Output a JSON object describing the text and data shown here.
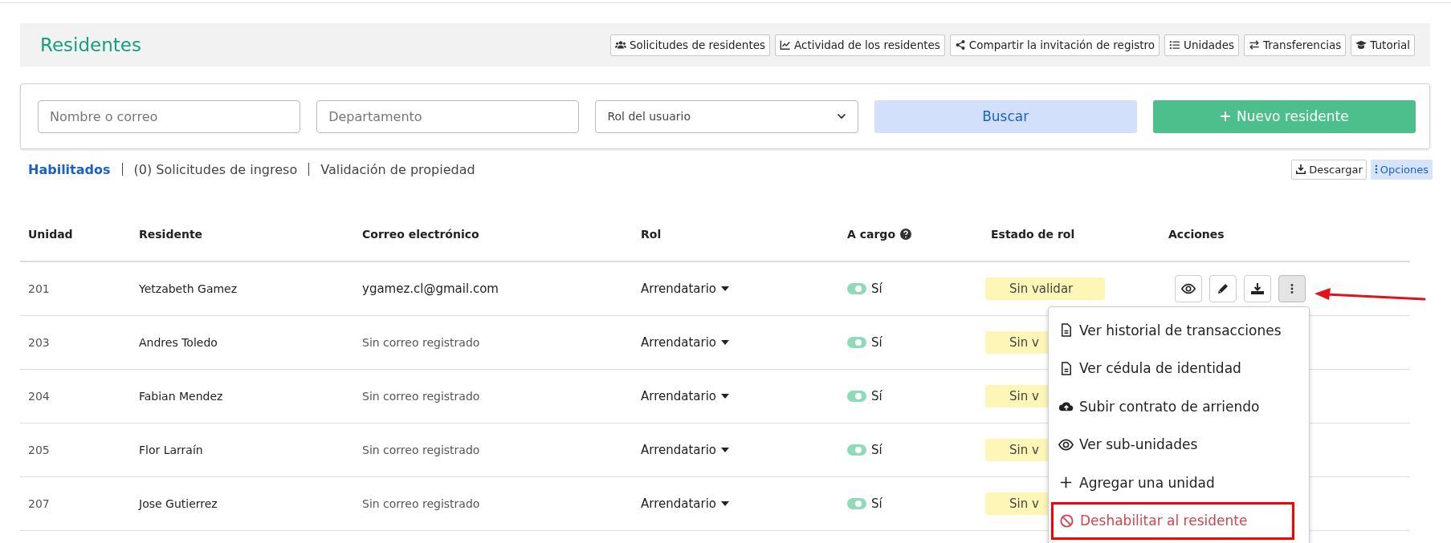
{
  "page": {
    "title": "Residentes"
  },
  "header_buttons": [
    {
      "label": "Solicitudes de residentes"
    },
    {
      "label": "Actividad de los residentes"
    },
    {
      "label": "Compartir la invitación de registro"
    },
    {
      "label": "Unidades"
    },
    {
      "label": "Transferencias"
    },
    {
      "label": "Tutorial"
    }
  ],
  "filters": {
    "name": {
      "placeholder": "Nombre o correo"
    },
    "department": {
      "placeholder": "Departamento"
    },
    "role": {
      "placeholder": "Rol del usuario"
    },
    "search_button": "Buscar",
    "new_button": "Nuevo residente"
  },
  "tabs": [
    {
      "label": "Habilitados",
      "selected": true
    },
    {
      "label": "(0) Solicitudes de ingreso",
      "selected": false
    },
    {
      "label": "Validación de propiedad",
      "selected": false
    }
  ],
  "toolbar": [
    {
      "label": "Descargar",
      "selected": false
    },
    {
      "label": "Opciones",
      "selected": true
    }
  ],
  "table": {
    "columns": [
      "Unidad",
      "Residente",
      "Correo electrónico",
      "Rol",
      "A cargo",
      "Estado de rol",
      "Acciones"
    ],
    "rows": [
      {
        "unit": "201",
        "resident": "Yetzabeth Gamez",
        "email": "ygamez.cl@gmail.com",
        "email_registered": true,
        "role": "Arrendatario",
        "in_charge": {
          "on": true,
          "label": "Sí"
        },
        "status": "Sin validar"
      },
      {
        "unit": "203",
        "resident": "Andres Toledo",
        "email": "Sin correo registrado",
        "email_registered": false,
        "role": "Arrendatario",
        "in_charge": {
          "on": true,
          "label": "Sí"
        },
        "status": "Sin v"
      },
      {
        "unit": "204",
        "resident": "Fabian Mendez",
        "email": "Sin correo registrado",
        "email_registered": false,
        "role": "Arrendatario",
        "in_charge": {
          "on": true,
          "label": "Sí"
        },
        "status": "Sin v"
      },
      {
        "unit": "205",
        "resident": "Flor Larraín",
        "email": "Sin correo registrado",
        "email_registered": false,
        "role": "Arrendatario",
        "in_charge": {
          "on": true,
          "label": "Sí"
        },
        "status": "Sin v"
      },
      {
        "unit": "207",
        "resident": "Jose Gutierrez",
        "email": "Sin correo registrado",
        "email_registered": false,
        "role": "Arrendatario",
        "in_charge": {
          "on": true,
          "label": "Sí"
        },
        "status": "Sin v"
      }
    ]
  },
  "actions_menu": {
    "open": true,
    "items": [
      {
        "label": "Ver historial de transacciones",
        "kind": "normal",
        "highlighted": false
      },
      {
        "label": "Ver cédula de identidad",
        "kind": "normal",
        "highlighted": false
      },
      {
        "label": "Subir contrato de arriendo",
        "kind": "normal",
        "highlighted": false
      },
      {
        "label": "Ver sub-unidades",
        "kind": "normal",
        "highlighted": false
      },
      {
        "label": "Agregar una unidad",
        "kind": "normal",
        "highlighted": false
      },
      {
        "label": "Deshabilitar al residente",
        "kind": "danger",
        "highlighted": true
      }
    ]
  }
}
